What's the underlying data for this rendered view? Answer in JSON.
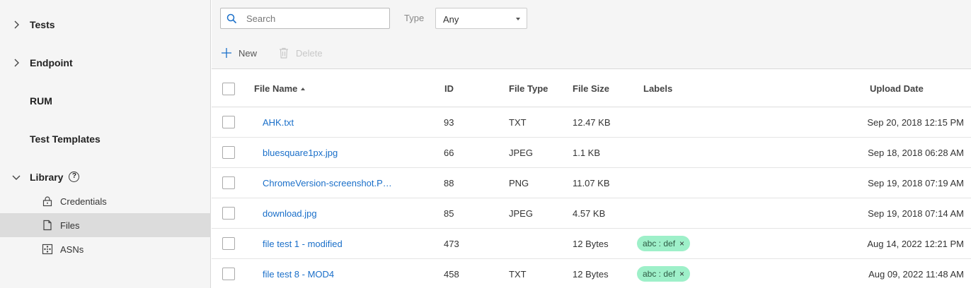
{
  "sidebar": {
    "items": [
      {
        "label": "Tests"
      },
      {
        "label": "Endpoint"
      },
      {
        "label": "RUM"
      },
      {
        "label": "Test Templates"
      },
      {
        "label": "Library"
      }
    ],
    "library_children": [
      {
        "label": "Credentials",
        "icon": "lock-icon"
      },
      {
        "label": "Files",
        "icon": "file-icon"
      },
      {
        "label": "ASNs",
        "icon": "network-icon"
      }
    ],
    "help_glyph": "?"
  },
  "toolbar": {
    "search_placeholder": "Search",
    "type_label": "Type",
    "type_value": "Any",
    "new_label": "New",
    "delete_label": "Delete"
  },
  "table": {
    "columns": {
      "name": "File Name",
      "id": "ID",
      "type": "File Type",
      "size": "File Size",
      "labels": "Labels",
      "date": "Upload Date"
    },
    "rows": [
      {
        "name": "AHK.txt",
        "id": "93",
        "type": "TXT",
        "size": "12.47 KB",
        "label": "",
        "date": "Sep 20, 2018 12:15 PM"
      },
      {
        "name": "bluesquare1px.jpg",
        "id": "66",
        "type": "JPEG",
        "size": "1.1 KB",
        "label": "",
        "date": "Sep 18, 2018 06:28 AM"
      },
      {
        "name": "ChromeVersion-screenshot.P…",
        "id": "88",
        "type": "PNG",
        "size": "11.07 KB",
        "label": "",
        "date": "Sep 19, 2018 07:19 AM"
      },
      {
        "name": "download.jpg",
        "id": "85",
        "type": "JPEG",
        "size": "4.57 KB",
        "label": "",
        "date": "Sep 19, 2018 07:14 AM"
      },
      {
        "name": "file test 1 - modified",
        "id": "473",
        "type": "",
        "size": "12 Bytes",
        "label": "abc : def",
        "date": "Aug 14, 2022 12:21 PM"
      },
      {
        "name": "file test 8 - MOD4",
        "id": "458",
        "type": "TXT",
        "size": "12 Bytes",
        "label": "abc : def",
        "date": "Aug 09, 2022 11:48 AM"
      }
    ],
    "chip_remove_glyph": "×"
  },
  "colors": {
    "link": "#1a6fc9",
    "chip": "#9ef0c9",
    "accent": "#1a6fc9"
  }
}
